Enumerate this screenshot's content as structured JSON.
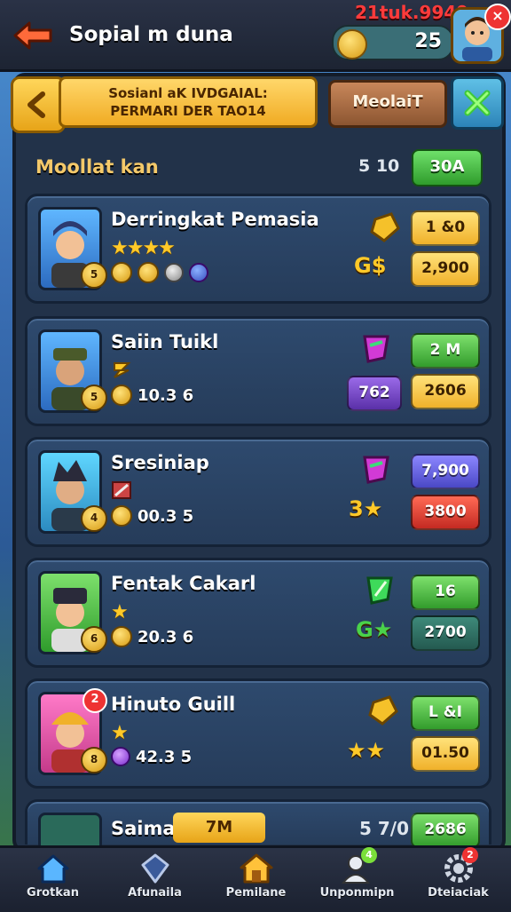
{
  "header": {
    "title": "Sopial m duna",
    "top_number": "21tuk.9949",
    "coin_count": "25",
    "close_badge": "×"
  },
  "panel": {
    "banner_line1": "Sosianl aK IVDGAIAL:",
    "banner_line2": "PERMARI DER TAO14",
    "modify_button": "MeolaiT",
    "section_title": "Moollat kan",
    "section_count": "5 10",
    "section_button": "30A"
  },
  "rows": [
    {
      "name": "Derringkat Pemasia",
      "stars": "★★★★",
      "value": "",
      "right_top": "1 &0",
      "right_bottom": "2,900",
      "side_label": "G$"
    },
    {
      "name": "Saiin Tuikl",
      "stars": "",
      "value": "10.3 6",
      "right_top": "2 M",
      "right_bottom": "2606",
      "side_label": "762"
    },
    {
      "name": "Sresiniap",
      "stars": "",
      "value": "00.3 5",
      "right_top": "7,900",
      "right_bottom": "3800",
      "side_label": "3★"
    },
    {
      "name": "Fentak Cakarl",
      "stars": "★",
      "value": "20.3 6",
      "right_top": "16",
      "right_bottom": "2700",
      "side_label": "G★"
    },
    {
      "name": "Hinuto Guill",
      "stars": "★",
      "value": "42.3 5",
      "right_top": "L &I",
      "right_bottom": "01.50",
      "side_label": "★★"
    }
  ],
  "partial_row": {
    "name": "Saiman",
    "tag": "7M",
    "side_label": "5 7/0",
    "right_pill": "2686"
  },
  "nav": [
    {
      "label": "Grotkan",
      "icon": "home-icon"
    },
    {
      "label": "Afunaila",
      "icon": "shield-icon"
    },
    {
      "label": "Pemilane",
      "icon": "house-icon"
    },
    {
      "label": "Unponmipn",
      "icon": "friends-icon"
    },
    {
      "label": "Dteiaciak",
      "icon": "settings-icon"
    }
  ],
  "colors": {
    "accent_gold": "#f0ab23",
    "panel_bg": "#223249",
    "green": "#329c2c"
  }
}
